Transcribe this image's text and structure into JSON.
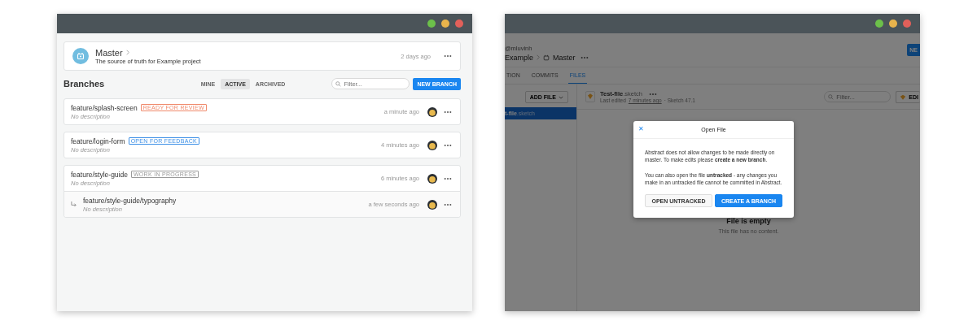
{
  "left_window": {
    "master": {
      "title": "Master",
      "description": "The source of truth for Example project",
      "time": "2 days ago"
    },
    "branches_heading": "Branches",
    "filters": [
      {
        "label": "MINE",
        "selected": false
      },
      {
        "label": "ACTIVE",
        "selected": true
      },
      {
        "label": "ARCHIVED",
        "selected": false
      }
    ],
    "filter_placeholder": "Filter...",
    "new_branch_button": "NEW BRANCH",
    "branches": [
      {
        "name": "feature/splash-screen",
        "status": "READY FOR REVIEW",
        "color": "#f08a6c",
        "description": "No description",
        "time": "a minute ago"
      },
      {
        "name": "feature/login-form",
        "status": "OPEN FOR FEEDBACK",
        "color": "#3a8ee6",
        "description": "No description",
        "time": "4 minutes ago"
      },
      {
        "name": "feature/style-guide",
        "status": "WORK IN PROGRESS",
        "color": "#9a9a9a",
        "description": "No description",
        "time": "6 minutes ago",
        "children": [
          {
            "name": "feature/style-guide/typography",
            "description": "No description",
            "time": "a few seconds ago"
          }
        ]
      }
    ]
  },
  "right_window": {
    "user": "@mluvinh",
    "project": "Example",
    "branch": "Master",
    "header_button": "NE",
    "tabs": [
      {
        "label": "TION",
        "selected": false
      },
      {
        "label": "COMMITS",
        "selected": false
      },
      {
        "label": "FILES",
        "selected": true
      }
    ],
    "add_file_button": "ADD FILE",
    "files": [
      {
        "name": "t-file",
        "ext": ".sketch",
        "selected": true
      }
    ],
    "file": {
      "name": "Test-file",
      "ext": ".sketch",
      "edited_prefix": "Last edited",
      "edited_link": "7 minutes ago",
      "edited_suffix": "· Sketch 47.1"
    },
    "filter_placeholder": "Filter...",
    "edit_button": "EDI",
    "empty": {
      "title": "File is empty",
      "text": "This file has no content."
    },
    "modal": {
      "title": "Open File",
      "close": "✕",
      "paragraphs": [
        "Abstract does not allow changes to be made directly on master. To make edits please **create a new branch**.",
        "You can also open the file **untracked** - any changes you make in an untracked file cannot be committed in Abstract."
      ],
      "buttons": [
        {
          "label": "OPEN UNTRACKED",
          "primary": false
        },
        {
          "label": "CREATE A BRANCH",
          "primary": true
        }
      ]
    }
  }
}
